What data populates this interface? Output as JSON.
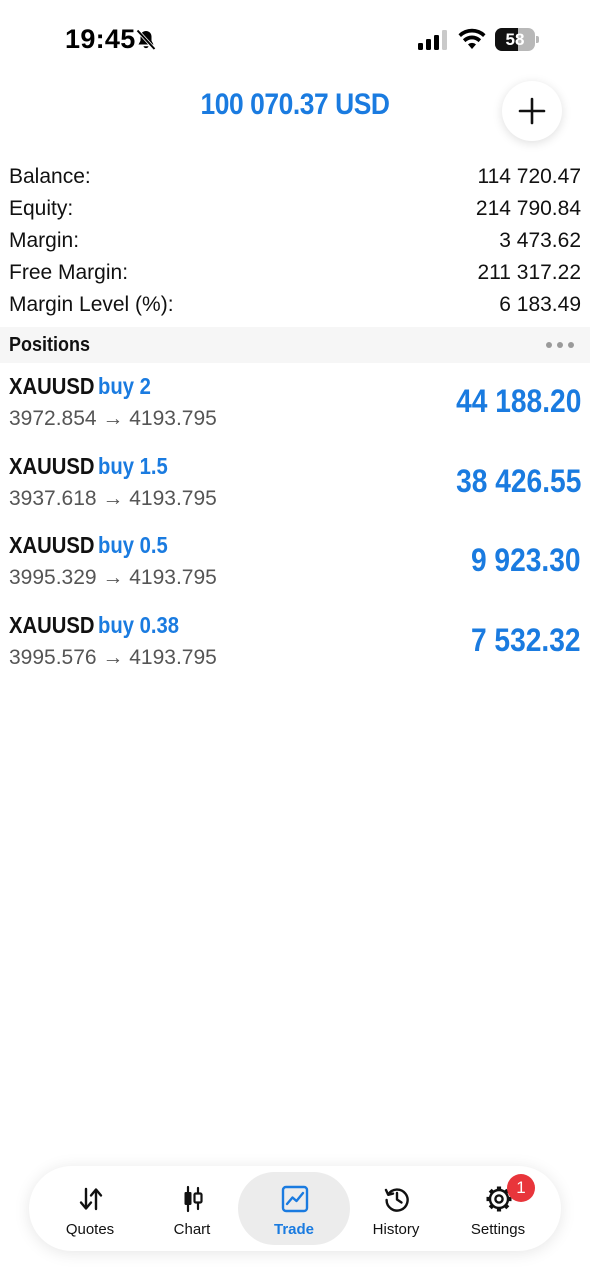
{
  "status_bar": {
    "time": "19:45",
    "battery_level": "58",
    "battery_fraction": 0.58,
    "icons": [
      "bell-slash-icon",
      "signal-icon",
      "wifi-icon",
      "battery-icon"
    ]
  },
  "header": {
    "total": "100 070.37 USD",
    "add_icon": "plus-icon"
  },
  "summary": [
    {
      "label": "Balance:",
      "value": "114 720.47"
    },
    {
      "label": "Equity:",
      "value": "214 790.84"
    },
    {
      "label": "Margin:",
      "value": "3 473.62"
    },
    {
      "label": "Free Margin:",
      "value": "211 317.22"
    },
    {
      "label": "Margin Level (%):",
      "value": "6 183.49"
    }
  ],
  "positions": {
    "title": "Positions",
    "items": [
      {
        "symbol": "XAUUSD",
        "direction": "buy 2",
        "prices": "3972.854 → 4193.795",
        "profit": "44 188.20"
      },
      {
        "symbol": "XAUUSD",
        "direction": "buy 1.5",
        "prices": "3937.618 → 4193.795",
        "profit": "38 426.55"
      },
      {
        "symbol": "XAUUSD",
        "direction": "buy 0.5",
        "prices": "3995.329 → 4193.795",
        "profit": "9 923.30"
      },
      {
        "symbol": "XAUUSD",
        "direction": "buy 0.38",
        "prices": "3995.576 → 4193.795",
        "profit": "7 532.32"
      }
    ]
  },
  "tabs": [
    {
      "label": "Quotes",
      "icon": "quotes-icon",
      "active": false
    },
    {
      "label": "Chart",
      "icon": "candlestick-icon",
      "active": false
    },
    {
      "label": "Trade",
      "icon": "trade-chart-icon",
      "active": true
    },
    {
      "label": "History",
      "icon": "history-icon",
      "active": false
    },
    {
      "label": "Settings",
      "icon": "gear-icon",
      "active": false
    }
  ],
  "settings_badge": "1",
  "colors": {
    "accent": "#1a7be0",
    "badge": "#e8353b",
    "active_tab_bg": "#ececec"
  }
}
